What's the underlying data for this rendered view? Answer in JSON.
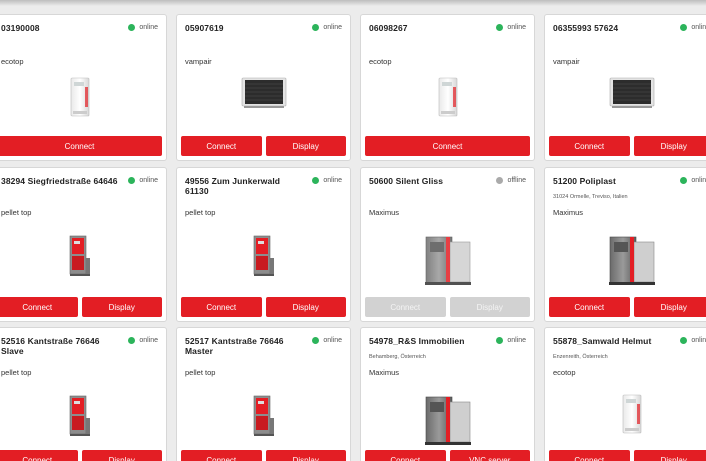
{
  "cards": [
    {
      "title": "03190008",
      "status": "online",
      "product": "ecotop",
      "address": "",
      "buttons": [
        "Connect"
      ],
      "device": "ecotop"
    },
    {
      "title": "05907619",
      "status": "online",
      "product": "vampair",
      "address": "",
      "buttons": [
        "Connect",
        "Display"
      ],
      "device": "vampair"
    },
    {
      "title": "06098267",
      "status": "online",
      "product": "ecotop",
      "address": "",
      "buttons": [
        "Connect"
      ],
      "device": "ecotop"
    },
    {
      "title": "06355993 57624",
      "status": "online",
      "product": "vampair",
      "address": "",
      "buttons": [
        "Connect",
        "Display"
      ],
      "device": "vampair"
    },
    {
      "title": "38294 Siegfriedstraße 64646",
      "status": "online",
      "product": "pellet top",
      "address": "",
      "buttons": [
        "Connect",
        "Display"
      ],
      "device": "pellet"
    },
    {
      "title": "49556 Zum Junkerwald 61130",
      "status": "online",
      "product": "pellet top",
      "address": "",
      "buttons": [
        "Connect",
        "Display"
      ],
      "device": "pellet"
    },
    {
      "title": "50600 Silent Gliss",
      "status": "offline",
      "product": "Maximus",
      "address": "",
      "buttons": [
        "Connect",
        "Display"
      ],
      "device": "maximus",
      "disabled": true
    },
    {
      "title": "51200 Poliplast",
      "status": "online",
      "product": "Maximus",
      "address": "31024 Ormelle, Treviso, Italien",
      "buttons": [
        "Connect",
        "Display"
      ],
      "device": "maximus"
    },
    {
      "title": "52516 Kantstraße 76646 Slave",
      "status": "online",
      "product": "pellet top",
      "address": "",
      "buttons": [
        "Connect",
        "Display"
      ],
      "device": "pellet"
    },
    {
      "title": "52517 Kantstraße 76646 Master",
      "status": "online",
      "product": "pellet top",
      "address": "",
      "buttons": [
        "Connect",
        "Display"
      ],
      "device": "pellet"
    },
    {
      "title": "54978_R&S Immobilien",
      "status": "online",
      "product": "Maximus",
      "address": "Behamberg, Österreich",
      "buttons": [
        "Connect",
        "VNC server"
      ],
      "device": "maximus"
    },
    {
      "title": "55878_Samwald Helmut",
      "status": "online",
      "product": "ecotop",
      "address": "Enzenreith, Österreich",
      "buttons": [
        "Connect",
        "Display"
      ],
      "device": "ecotop"
    }
  ],
  "colors": {
    "accent": "#e31e24",
    "online": "#2cb45b",
    "offline": "#aaaaaa"
  }
}
